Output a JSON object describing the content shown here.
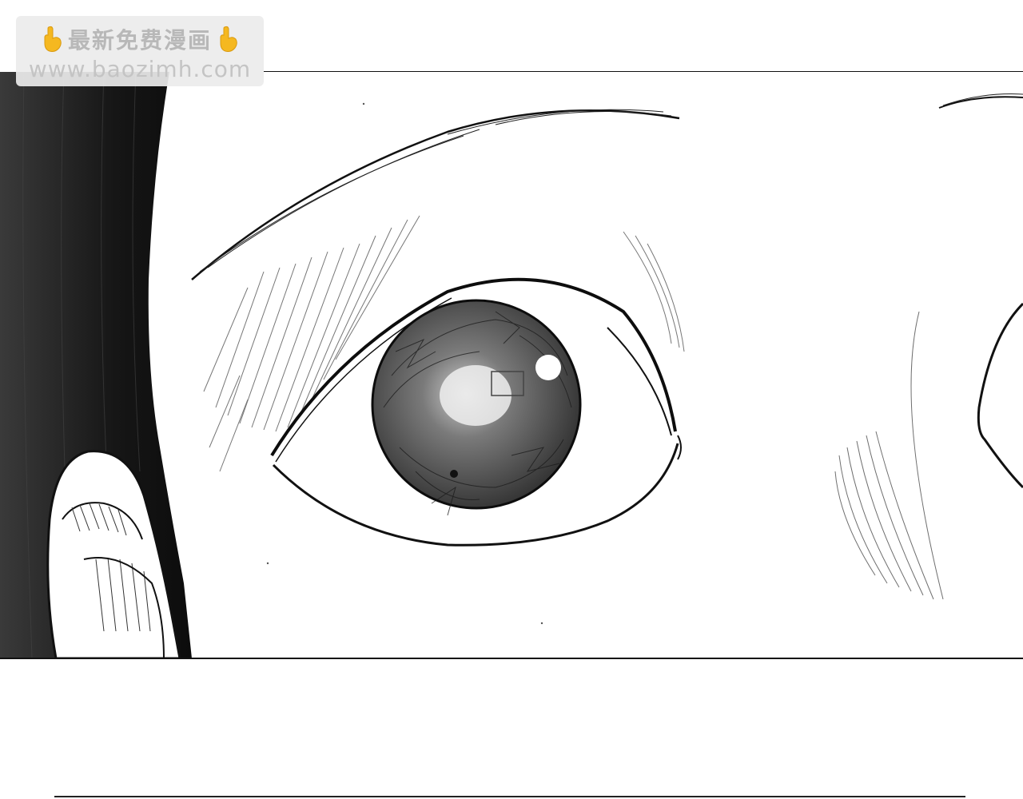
{
  "watermark": {
    "title": "最新免费漫画",
    "url": "www.baozimh.com",
    "icons": [
      "pointing-down-hand-icon",
      "pointing-down-hand-icon"
    ]
  },
  "colors": {
    "ink": "#111111",
    "hair": "#1a1a1a",
    "iris": "#555555",
    "watermark_bg": "#ebebeb",
    "hand_yellow": "#f5b820"
  }
}
